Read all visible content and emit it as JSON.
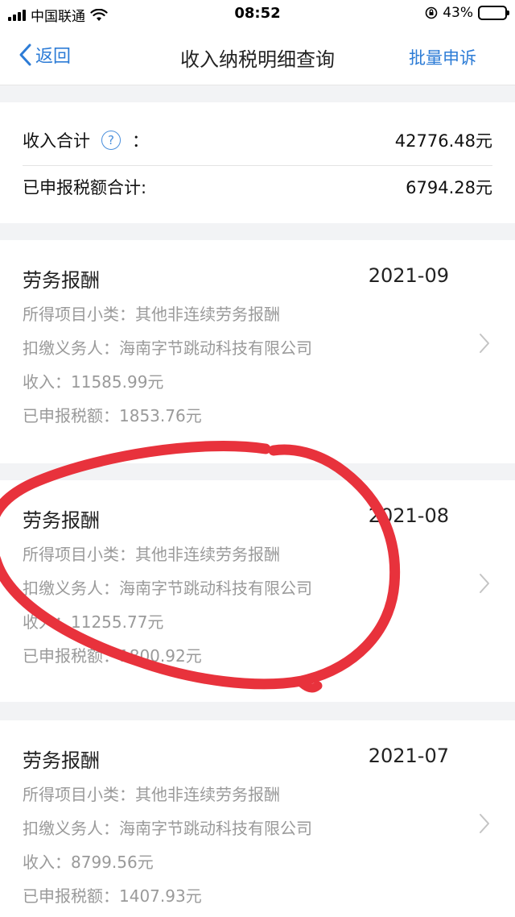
{
  "status_bar": {
    "carrier": "中国联通",
    "time": "08:52",
    "battery": "43%",
    "battery_level": 0.43
  },
  "nav": {
    "back_label": "返回",
    "title": "收入纳税明细查询",
    "action_label": "批量申诉"
  },
  "summary": {
    "income_label": "收入合计",
    "income_colon": "：",
    "income_value": "42776.48元",
    "tax_label": "已申报税额合计:",
    "tax_value": "6794.28元"
  },
  "records": [
    {
      "title": "劳务报酬",
      "period": "2021-09",
      "subcategory": "所得项目小类：其他非连续劳务报酬",
      "withholder": "扣缴义务人：海南字节跳动科技有限公司",
      "income": "收入：11585.99元",
      "tax": "已申报税额：1853.76元"
    },
    {
      "title": "劳务报酬",
      "period": "2021-08",
      "subcategory": "所得项目小类：其他非连续劳务报酬",
      "withholder": "扣缴义务人：海南字节跳动科技有限公司",
      "income": "收入：11255.77元",
      "tax": "已申报税额：1800.92元"
    },
    {
      "title": "劳务报酬",
      "period": "2021-07",
      "subcategory": "所得项目小类：其他非连续劳务报酬",
      "withholder": "扣缴义务人：海南字节跳动科技有限公司",
      "income": "收入：8799.56元",
      "tax": "已申报税额：1407.93元"
    }
  ],
  "colors": {
    "accent": "#2d7cd6",
    "annotation": "#e8323c"
  }
}
